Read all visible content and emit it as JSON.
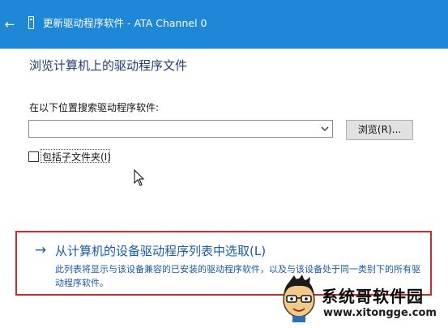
{
  "window": {
    "title": "更新驱动程序软件 - ATA Channel 0",
    "back_icon": "back-arrow-icon",
    "device_icon": "device-icon",
    "titlebar_color": "#1e88d6"
  },
  "main": {
    "heading": "浏览计算机上的驱动程序文件",
    "search_label": "在以下位置搜索驱动程序软件:",
    "path_value": "",
    "browse_label": "浏览(R)...",
    "subfolder_label": "包括子文件夹(I)",
    "subfolder_checked": false
  },
  "pick_option": {
    "arrow": "→",
    "title": "从计算机的设备驱动程序列表中选取(L)",
    "description": "此列表将显示与该设备兼容的已安装的驱动程序软件，以及与该设备处于同一类别下的所有驱动程序软件。",
    "highlight_color": "#d22a26"
  },
  "watermark": {
    "title": "系统哥软件园",
    "url": "www.xitongge.com"
  }
}
